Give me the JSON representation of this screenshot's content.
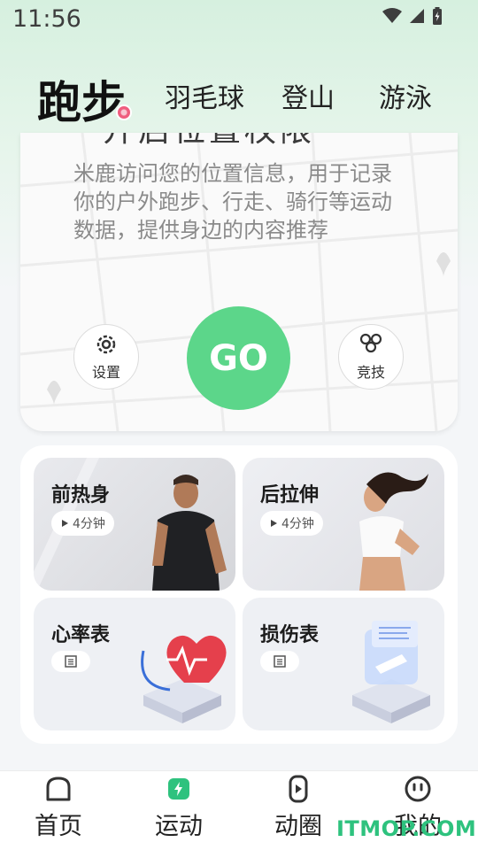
{
  "status_bar": {
    "time": "11:56"
  },
  "sport_tabs": [
    {
      "label": "跑步",
      "active": true
    },
    {
      "label": "羽毛球",
      "active": false
    },
    {
      "label": "登山",
      "active": false
    },
    {
      "label": "游泳",
      "active": false
    }
  ],
  "location_card": {
    "title": "开启位置权限",
    "description": "米鹿访问您的位置信息，用于记录你的户外跑步、行走、骑行等运动数据，提供身边的内容推荐",
    "settings_label": "设置",
    "go_label": "GO",
    "compete_label": "竞技"
  },
  "tiles": [
    {
      "title": "前热身",
      "duration": "4分钟",
      "icon": "play-icon"
    },
    {
      "title": "后拉伸",
      "duration": "4分钟",
      "icon": "play-icon"
    },
    {
      "title": "心率表",
      "icon": "document-icon"
    },
    {
      "title": "损伤表",
      "icon": "document-icon"
    }
  ],
  "bottom_nav": [
    {
      "label": "首页",
      "icon": "home-icon",
      "active": false
    },
    {
      "label": "运动",
      "icon": "sport-icon",
      "active": true
    },
    {
      "label": "动圈",
      "icon": "moments-icon",
      "active": false
    },
    {
      "label": "我的",
      "icon": "profile-icon",
      "active": false
    }
  ],
  "watermark": "ITMOP.COM",
  "colors": {
    "accent_green": "#5cd68a",
    "nav_active_green": "#2ec27e",
    "badge_pink": "#ef5d7e"
  }
}
